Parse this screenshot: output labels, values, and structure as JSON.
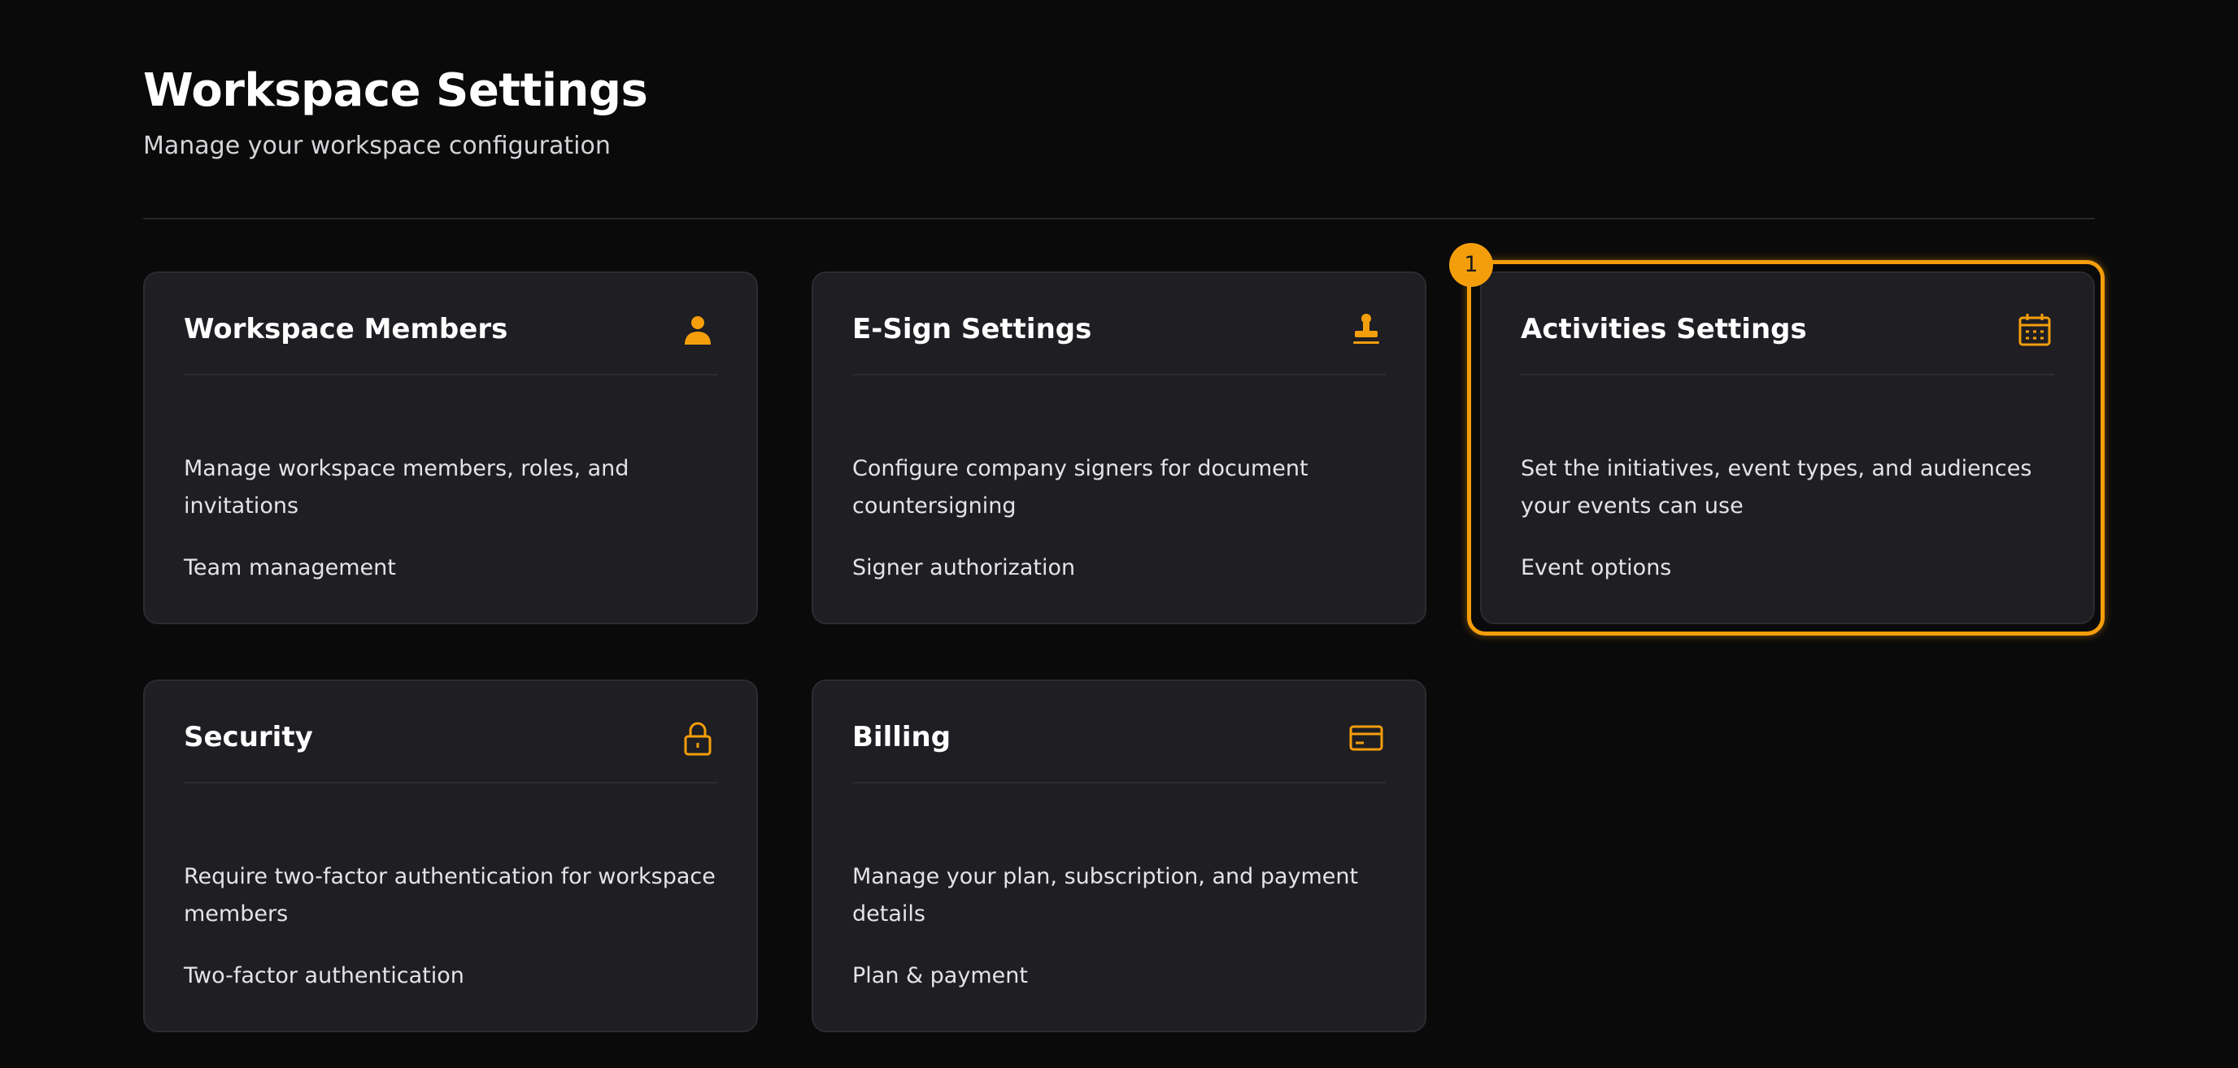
{
  "header": {
    "title": "Workspace Settings",
    "subtitle": "Manage your workspace configuration"
  },
  "accent_color": "#f59e0b",
  "cards": [
    {
      "title": "Workspace Members",
      "icon": "user-icon",
      "description": "Manage workspace members, roles, and invitations",
      "tag": "Team management"
    },
    {
      "title": "E-Sign Settings",
      "icon": "stamp-icon",
      "description": "Configure company signers for document countersigning",
      "tag": "Signer authorization"
    },
    {
      "title": "Activities Settings",
      "icon": "calendar-icon",
      "description": "Set the initiatives, event types, and audiences your events can use",
      "tag": "Event options"
    },
    {
      "title": "Security",
      "icon": "lock-icon",
      "description": "Require two-factor authentication for workspace members",
      "tag": "Two-factor authentication"
    },
    {
      "title": "Billing",
      "icon": "credit-card-icon",
      "description": "Manage your plan, subscription, and payment details",
      "tag": "Plan & payment"
    }
  ],
  "highlight_badge": "1"
}
